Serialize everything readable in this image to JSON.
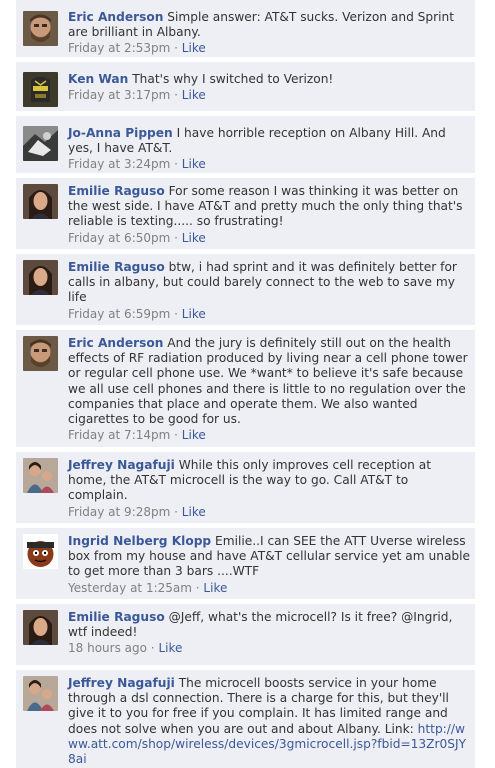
{
  "colors": {
    "comment_background": "#edeff4",
    "link": "#3b5998",
    "meta_text": "#808080",
    "body_text": "#333333"
  },
  "comments": [
    {
      "author": "Eric Anderson",
      "text": "Simple answer: AT&T sucks. Verizon and Sprint are brilliant in Albany.",
      "time": "Friday at 2:53pm",
      "separator": "·",
      "like": "Like",
      "avatar_icon": "bearded-man-photo"
    },
    {
      "author": "Ken Wan",
      "text": "That's why I switched to Verizon!",
      "time": "Friday at 3:17pm",
      "separator": "·",
      "like": "Like",
      "avatar_icon": "sports-jersey-photo"
    },
    {
      "author": "Jo-Anna Pippen",
      "text": "I have horrible reception on Albany Hill. And yes, I have AT&T.",
      "time": "Friday at 3:24pm",
      "separator": "·",
      "like": "Like",
      "avatar_icon": "black-and-white-photo"
    },
    {
      "author": "Emilie Raguso",
      "text": "For some reason I was thinking it was better on the west side. I have AT&T and pretty much the only thing that's reliable is texting..... so frustrating!",
      "time": "Friday at 6:50pm",
      "separator": "·",
      "like": "Like",
      "avatar_icon": "woman-portrait-photo"
    },
    {
      "author": "Emilie Raguso",
      "text": "btw, i had sprint and it was definitely better for calls in albany, but could barely connect to the web to save my life",
      "time": "Friday at 6:59pm",
      "separator": "·",
      "like": "Like",
      "avatar_icon": "woman-portrait-photo"
    },
    {
      "author": "Eric Anderson",
      "text": "And the jury is definitely still out on the health effects of RF radiation produced by living near a cell phone tower or regular cell phone use. We *want* to believe it's safe because we all use cell phones and there is little to no regulation over the companies that place and operate them. We also wanted cigarettes to be good for us.",
      "time": "Friday at 7:14pm",
      "separator": "·",
      "like": "Like",
      "avatar_icon": "bearded-man-photo"
    },
    {
      "author": "Jeffrey Nagafuji",
      "text": "While this only improves cell reception at home, the AT&T microcell is the way to go. Call AT&T to complain.",
      "time": "Friday at 9:28pm",
      "separator": "·",
      "like": "Like",
      "avatar_icon": "family-photo"
    },
    {
      "author": "Ingrid Nelberg Klopp",
      "text": "Emilie..I can SEE the ATT Uverse wireless box from my house and have AT&T cellular service yet am unable to get more than 3 bars ....WTF",
      "time": "Yesterday at 1:25am",
      "separator": "·",
      "like": "Like",
      "avatar_icon": "cartoon-character-avatar"
    },
    {
      "author": "Emilie Raguso",
      "text": "@Jeff, what's the microcell? Is it free? @Ingrid, wtf indeed!",
      "time": "18 hours ago",
      "separator": "·",
      "like": "Like",
      "avatar_icon": "woman-portrait-photo"
    },
    {
      "author": "Jeffrey Nagafuji",
      "text": "The microcell boosts service in your home through a dsl connection. There is a charge for this, but they'll give it to you for free if you complain. It has limited range and does not solve when you are out and about Albany. Link:",
      "link_text": "http://www.att.com/shop/wireless/devices/3gmicrocell.jsp?fbid=13Zr0SJY8ai",
      "time": "",
      "separator": "",
      "like": "",
      "avatar_icon": "family-photo"
    }
  ]
}
